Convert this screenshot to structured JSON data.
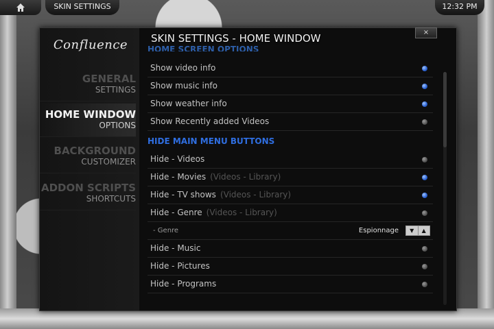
{
  "topbar": {
    "breadcrumb": "SKIN SETTINGS",
    "clock": "12:32 PM"
  },
  "dialog": {
    "title": "SKIN SETTINGS - HOME WINDOW",
    "close_label": "×",
    "logo": "Confluence"
  },
  "menu": [
    {
      "big": "GENERAL",
      "small": "SETTINGS",
      "active": false
    },
    {
      "big": "HOME WINDOW",
      "small": "OPTIONS",
      "active": true
    },
    {
      "big": "BACKGROUND",
      "small": "CUSTOMIZER",
      "active": false
    },
    {
      "big": "ADDON SCRIPTS",
      "small": "SHORTCUTS",
      "active": false
    }
  ],
  "cut_section_header": "HOME SCREEN OPTIONS",
  "home_options": [
    {
      "label": "Show video info",
      "on": true
    },
    {
      "label": "Show music info",
      "on": true
    },
    {
      "label": "Show weather info",
      "on": true
    },
    {
      "label": "Show Recently added Videos",
      "on": false
    }
  ],
  "hide_section_title": "HIDE MAIN MENU BUTTONS",
  "hide_options": [
    {
      "label": "Hide - Videos",
      "sub": "",
      "on": false
    },
    {
      "label": "Hide - Movies",
      "sub": "(Videos - Library)",
      "on": true
    },
    {
      "label": "Hide - TV shows",
      "sub": "(Videos - Library)",
      "on": true
    },
    {
      "label": "Hide - Genre",
      "sub": "(Videos - Library)",
      "on": false
    }
  ],
  "genre": {
    "label": "- Genre",
    "value": "Espionnage"
  },
  "more_hide_options": [
    {
      "label": "Hide - Music",
      "on": false
    },
    {
      "label": "Hide - Pictures",
      "on": false
    },
    {
      "label": "Hide - Programs",
      "on": false
    }
  ],
  "colors": {
    "accent_blue": "#2f6ee0",
    "radio_on": "#2a5fd0"
  }
}
